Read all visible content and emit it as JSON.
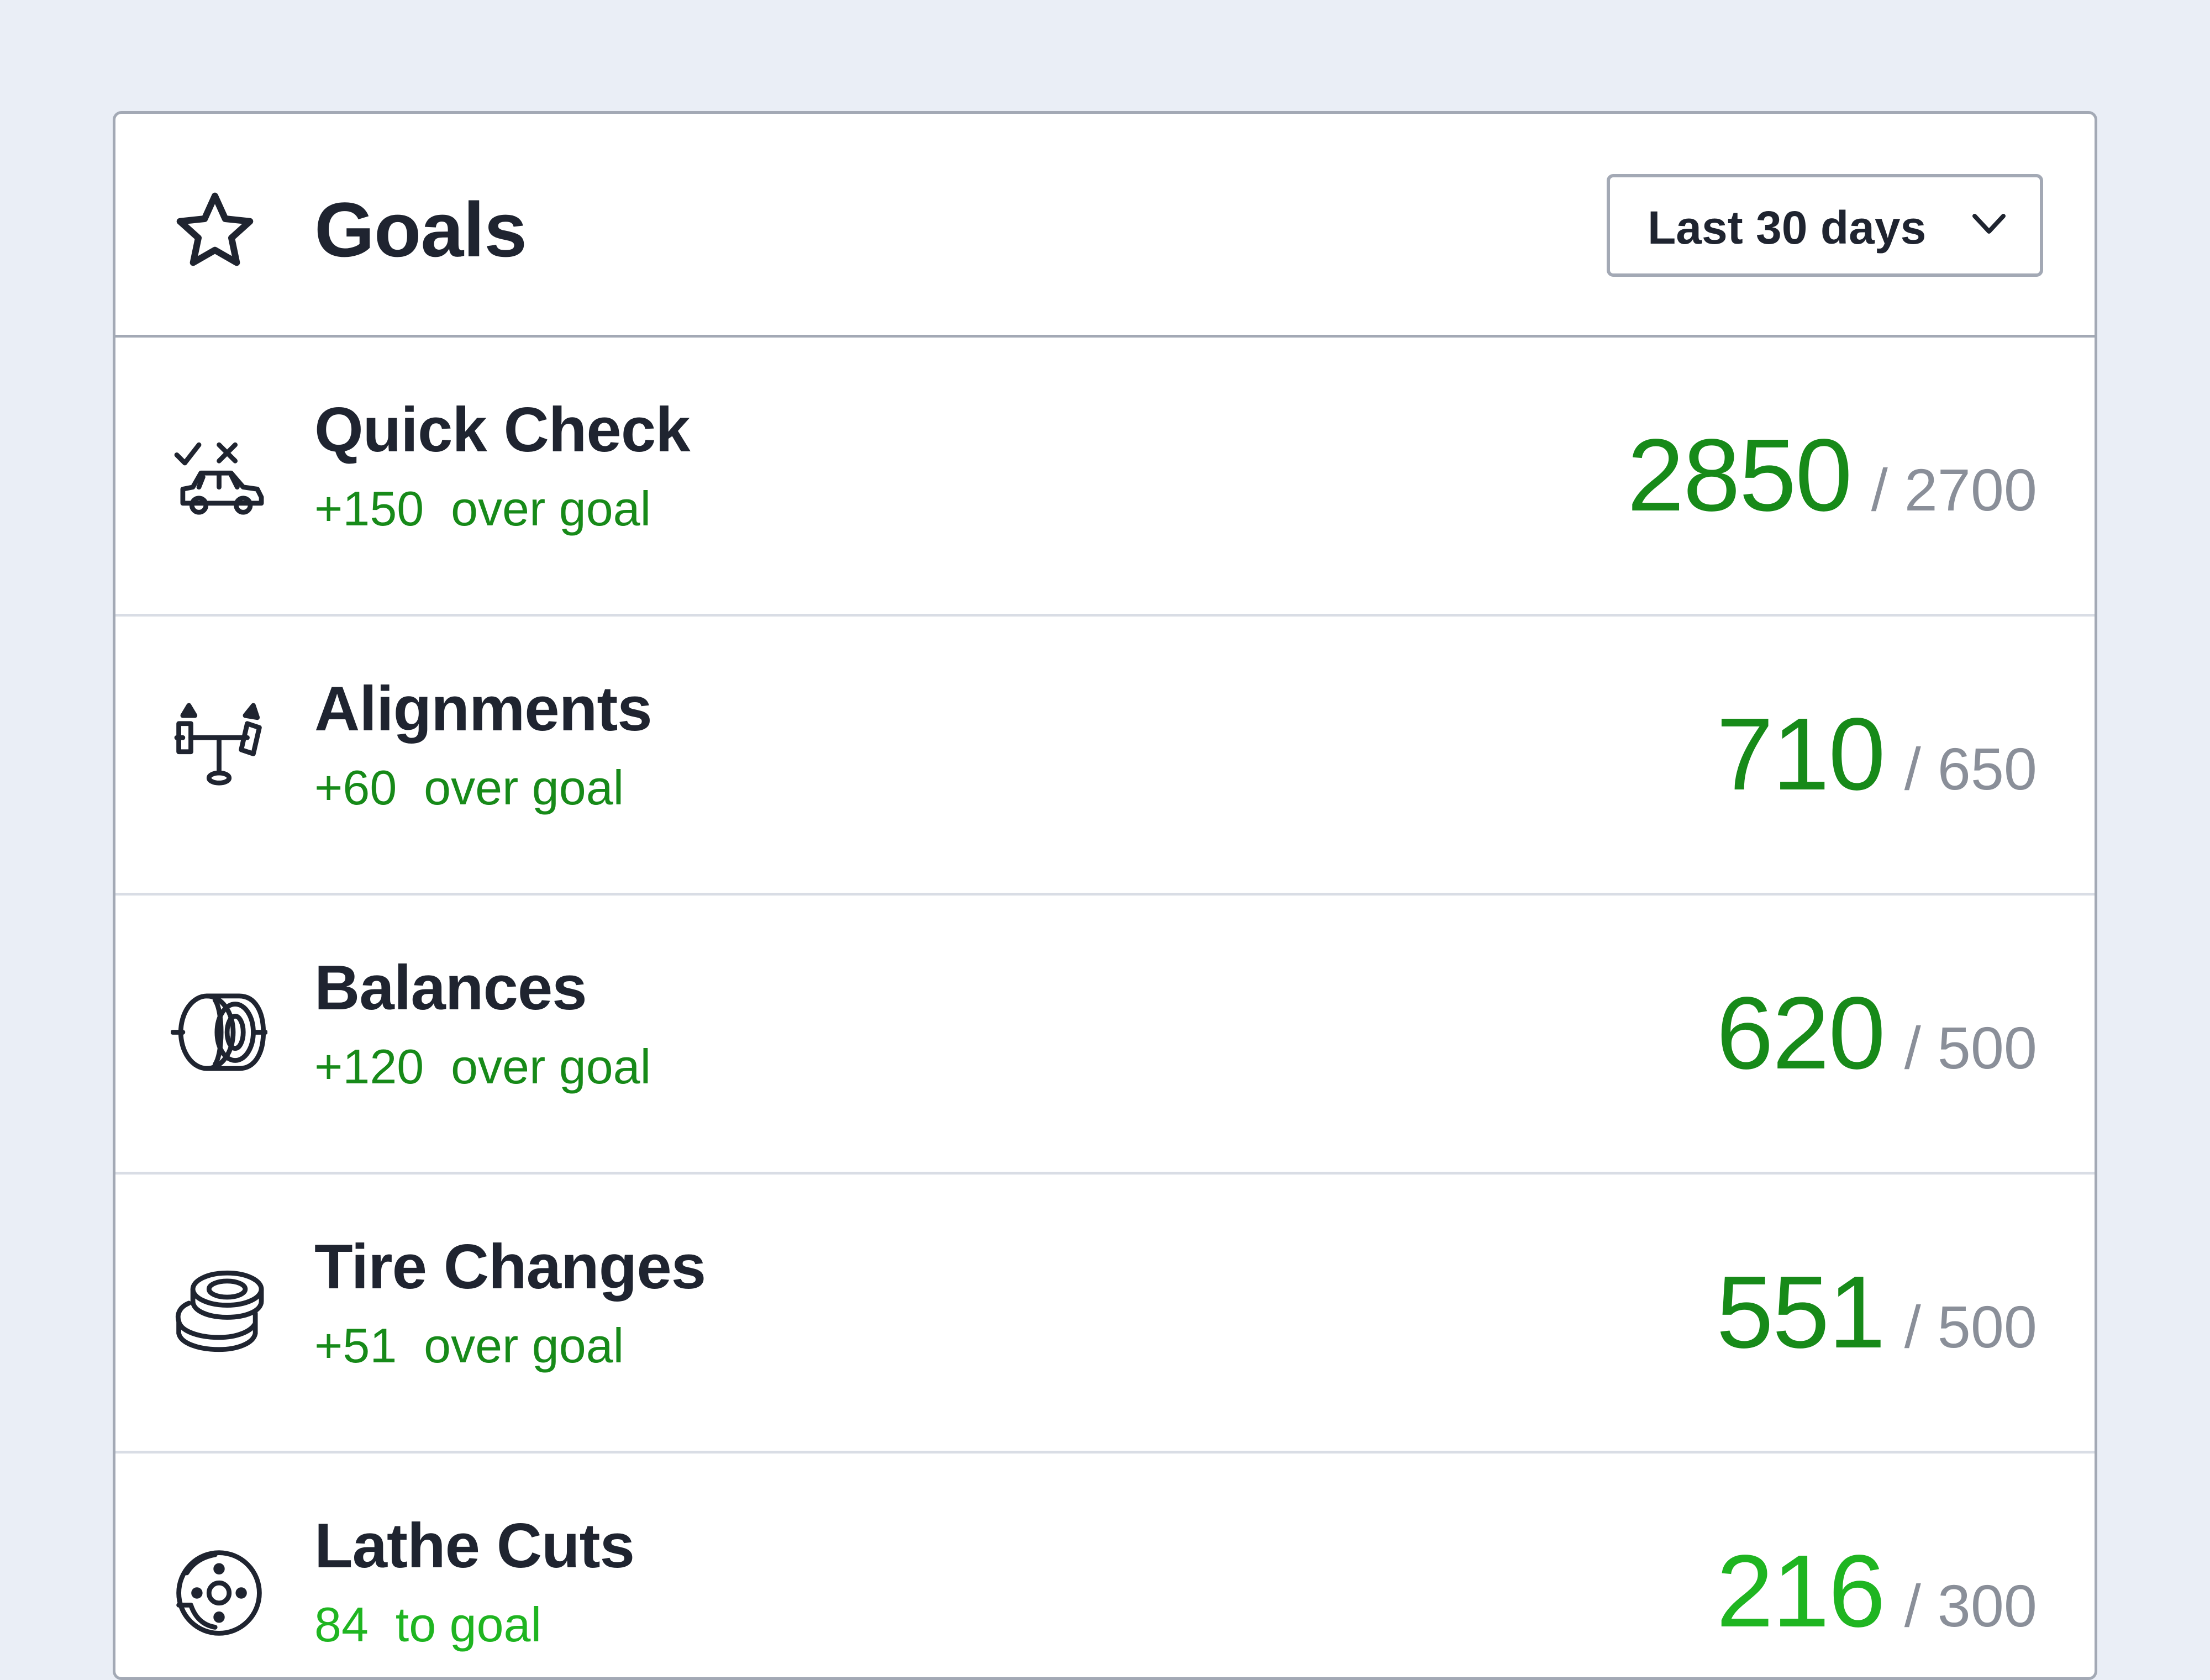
{
  "header": {
    "title": "Goals",
    "icon": "star-icon",
    "range": {
      "selected": "Last 30 days",
      "icon": "chevron-down-icon"
    }
  },
  "goals": [
    {
      "name": "Quick Check",
      "icon": "car-check-icon",
      "delta": "+150  over goal",
      "value": "2850",
      "goal": "/ 2700",
      "status": "over"
    },
    {
      "name": "Alignments",
      "icon": "alignment-icon",
      "delta": "+60  over goal",
      "value": "710",
      "goal": "/ 650",
      "status": "over"
    },
    {
      "name": "Balances",
      "icon": "tire-balance-icon",
      "delta": "+120  over goal",
      "value": "620",
      "goal": "/ 500",
      "status": "over"
    },
    {
      "name": "Tire Changes",
      "icon": "tire-stack-icon",
      "delta": "+51  over goal",
      "value": "551",
      "goal": "/ 500",
      "status": "over"
    },
    {
      "name": "Lathe Cuts",
      "icon": "brake-rotor-icon",
      "delta": "84  to goal",
      "value": "216",
      "goal": "/ 300",
      "status": "under"
    }
  ],
  "colors": {
    "background": "#eaeef6",
    "over_goal": "#178a19",
    "under_goal": "#1fb521",
    "goal_text": "#8a8f99",
    "text": "#1f2430",
    "border": "#a3a9b5"
  }
}
